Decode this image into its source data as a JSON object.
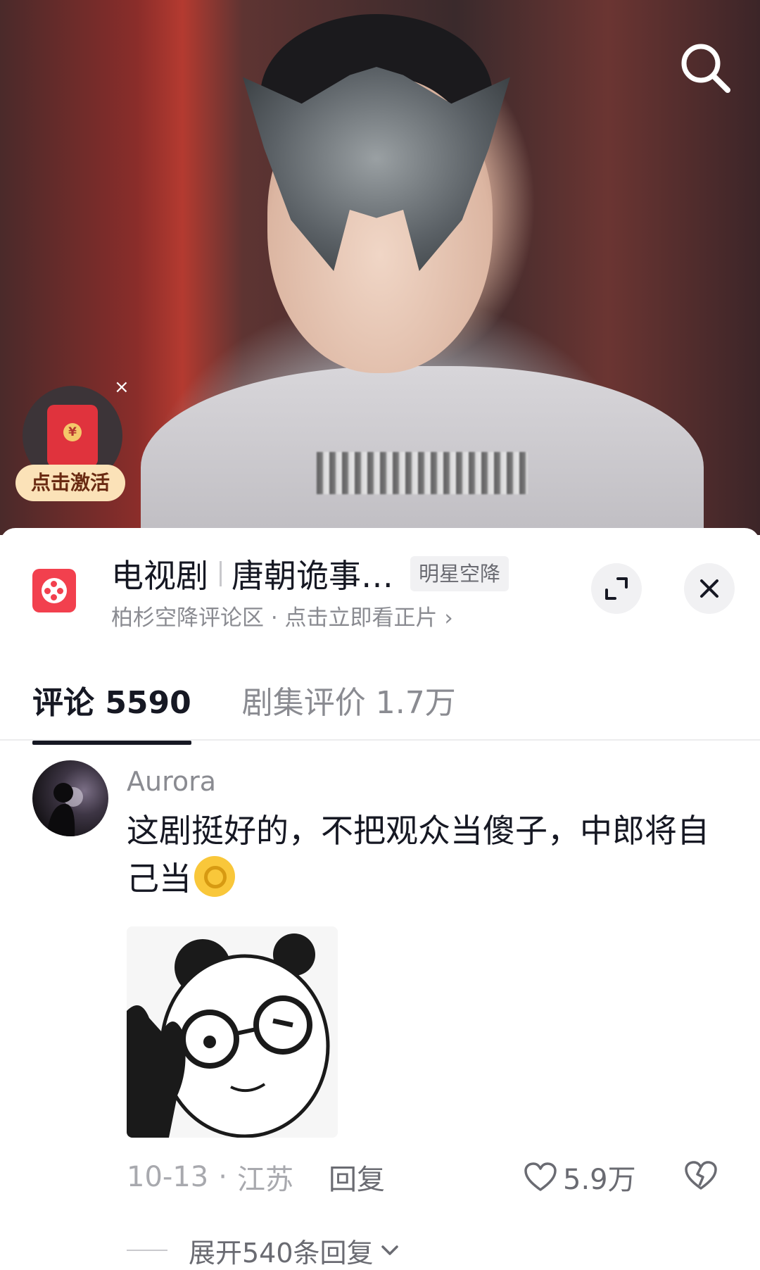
{
  "video": {
    "icons": {
      "search": "search-icon",
      "red_packet": "red-envelope-icon",
      "close": "close-icon"
    },
    "red_packet_label": "点击激活",
    "red_packet_close": "×"
  },
  "header": {
    "category": "电视剧",
    "title": "唐朝诡事…",
    "tag": "明星空降",
    "subtitle": "柏杉空降评论区 · 点击立即看正片",
    "subtitle_chevron": "›",
    "icons": {
      "drama": "film-reel-icon",
      "expand": "expand-icon",
      "close": "close-icon"
    }
  },
  "tabs": [
    {
      "label": "评论 5590",
      "active": true
    },
    {
      "label": "剧集评价 1.7万",
      "active": false
    }
  ],
  "comment": {
    "username": "Aurora",
    "text": "这剧挺好的，不把观众当傻子，中郎将自己当",
    "emoji": "ok-hand-emoji",
    "date": "10-13",
    "separator": "·",
    "location": "江苏",
    "reply_label": "回复",
    "likes": "5.9万",
    "expand_label": "展开540条回复",
    "icons": {
      "like": "heart-icon",
      "dislike": "broken-heart-icon",
      "expand": "chevron-down-icon"
    }
  },
  "colors": {
    "accent": "#f2404e",
    "text": "#161823",
    "muted": "#8a8b91"
  }
}
